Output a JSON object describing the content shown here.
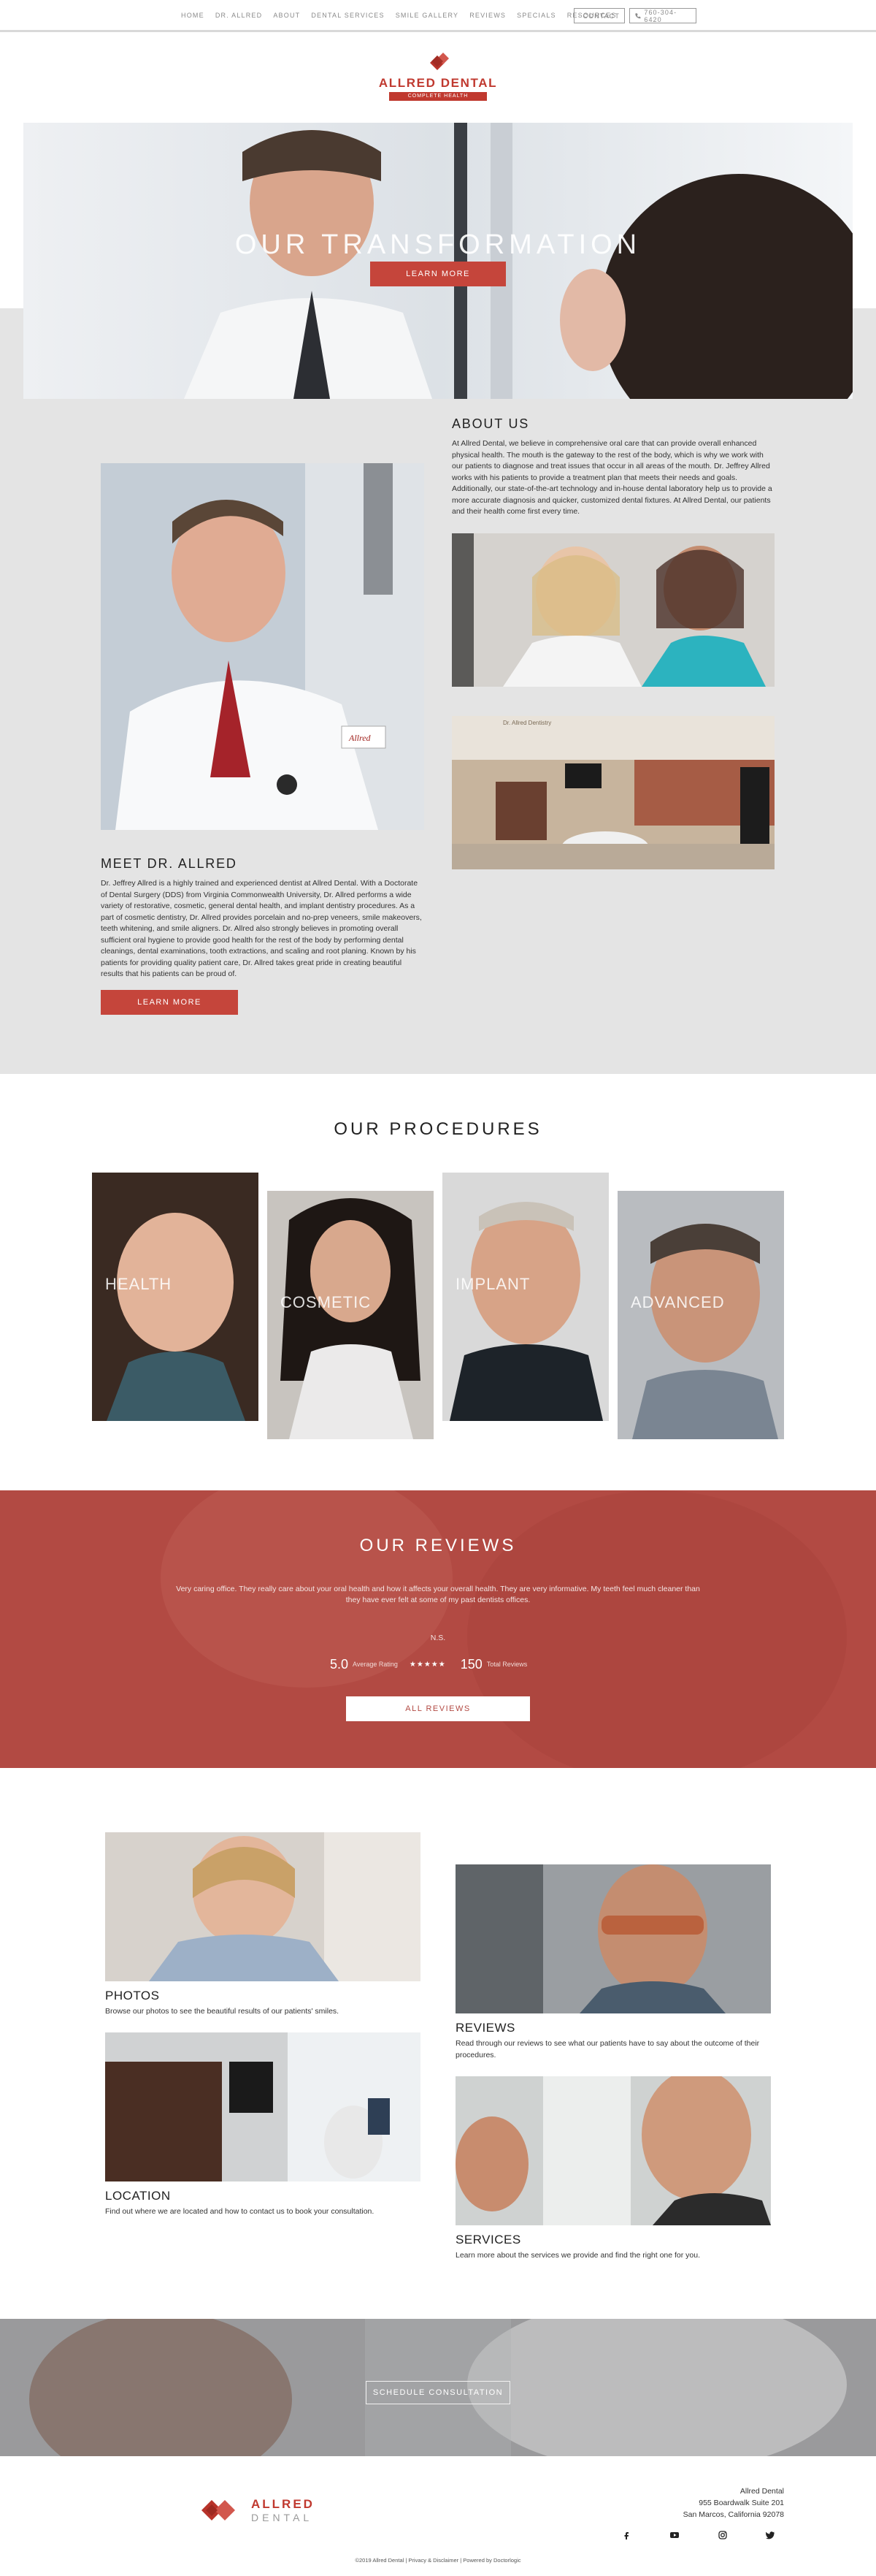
{
  "nav": {
    "links": [
      "HOME",
      "DR. ALLRED",
      "ABOUT",
      "DENTAL SERVICES",
      "SMILE GALLERY",
      "REVIEWS",
      "SPECIALS",
      "RESOURCES"
    ],
    "contact_label": "CONTACT",
    "phone_label": "760-304-6420"
  },
  "logo": {
    "name": "ALLRED DENTAL",
    "tagline": "COMPLETE HEALTH DENTISTRY"
  },
  "hero": {
    "title": "OUR TRANSFORMATION",
    "button": "LEARN MORE"
  },
  "about": {
    "heading": "ABOUT US",
    "text": "At Allred Dental, we believe in comprehensive oral care that can provide overall enhanced physical health. The mouth is the gateway to the rest of the body, which is why we work with our patients to diagnose and treat issues that occur in all areas of the mouth. Dr. Jeffrey Allred works with his patients to provide a treatment plan that meets their needs and goals. Additionally, our state-of-the-art technology and in-house dental laboratory help us to provide a more accurate diagnosis and quicker, customized dental fixtures. At Allred Dental, our patients and their health come first every time."
  },
  "doctor": {
    "heading": "MEET DR. ALLRED",
    "text": "Dr. Jeffrey Allred is a highly trained and experienced dentist at Allred Dental. With a Doctorate of Dental Surgery (DDS) from Virginia Commonwealth University, Dr. Allred performs a wide variety of restorative, cosmetic, general dental health, and implant dentistry procedures. As a part of cosmetic dentistry, Dr. Allred provides porcelain and no-prep veneers, smile makeovers, teeth whitening, and smile aligners. Dr. Allred also strongly believes in promoting overall sufficient oral hygiene to provide good health for the rest of the body by performing dental cleanings, dental examinations, tooth extractions, and scaling and root planing. Known by his patients for providing quality patient care, Dr. Allred takes great pride in creating beautiful results that his patients can be proud of.",
    "button": "LEARN MORE",
    "badge_text": "Allred"
  },
  "office": {
    "sign_text": "Dr. Allred Dentistry"
  },
  "procedures": {
    "heading": "OUR PROCEDURES",
    "items": [
      "HEALTH",
      "COSMETIC",
      "IMPLANT",
      "ADVANCED"
    ]
  },
  "reviews": {
    "heading": "OUR REVIEWS",
    "quote": "Very caring office. They really care about your oral health and how it affects your overall health. They are very informative. My teeth feel much cleaner than they have ever felt at some of my past dentists offices.",
    "author": "N.S.",
    "rating": "5.0",
    "rating_label": "Average Rating",
    "stars": "★★★★★",
    "total": "150",
    "total_label": "Total Reviews",
    "button": "ALL REVIEWS"
  },
  "features": [
    {
      "title": "PHOTOS",
      "text": "Browse our photos to see the beautiful results of our patients' smiles."
    },
    {
      "title": "REVIEWS",
      "text": "Read through our reviews to see what our patients have to say about the outcome of their procedures."
    },
    {
      "title": "LOCATION",
      "text": "Find out where we are located and how to contact us to book your consultation."
    },
    {
      "title": "SERVICES",
      "text": "Learn more about the services we provide and find the right one for you."
    }
  ],
  "cta": {
    "button": "SCHEDULE CONSULTATION"
  },
  "footer": {
    "logo_top": "ALLRED",
    "logo_bottom": "DENTAL",
    "address_name": "Allred Dental",
    "address_line1": "955 Boardwalk Suite 201",
    "address_line2": "San Marcos, California 92078",
    "copyright": "©2019 Allred Dental | Privacy & Disclaimer | Powered by Doctorlogic",
    "social": [
      "facebook-icon",
      "youtube-icon",
      "instagram-icon",
      "twitter-icon"
    ]
  },
  "colors": {
    "accent": "#c5453b",
    "reviews_bg": "#b24a43",
    "grey_band": "#e4e4e4"
  }
}
